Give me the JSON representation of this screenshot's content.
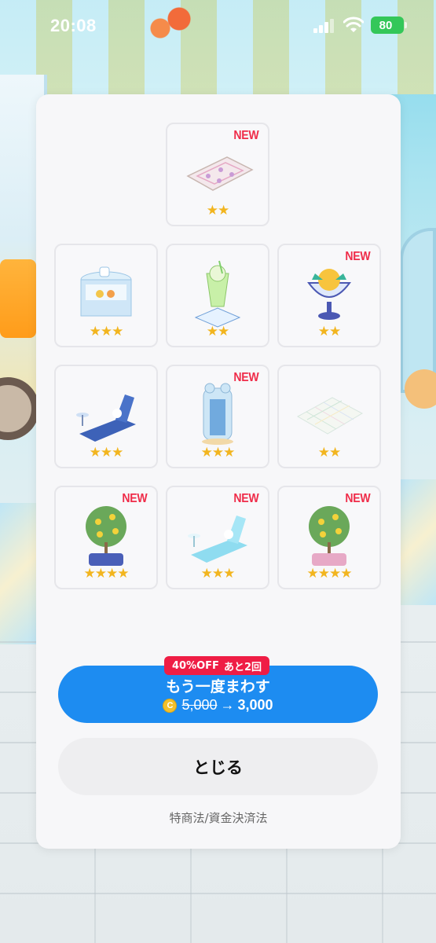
{
  "status_bar": {
    "time": "20:08",
    "battery": "80"
  },
  "items": [
    {
      "name": "tile-rug",
      "is_new": true,
      "stars": "★★"
    },
    {
      "name": "shop-counter",
      "is_new": false,
      "stars": "★★★"
    },
    {
      "name": "melon-soda",
      "is_new": false,
      "stars": "★★"
    },
    {
      "name": "mango-parfait",
      "is_new": true,
      "stars": "★★"
    },
    {
      "name": "blue-lounge-chair",
      "is_new": false,
      "stars": "★★★"
    },
    {
      "name": "shower-booth",
      "is_new": true,
      "stars": "★★★"
    },
    {
      "name": "pastel-floor-tile",
      "is_new": false,
      "stars": "★★"
    },
    {
      "name": "lemon-tree-blue",
      "is_new": true,
      "stars": "★★★★"
    },
    {
      "name": "aqua-lounge-chair",
      "is_new": true,
      "stars": "★★★"
    },
    {
      "name": "lemon-tree-pink",
      "is_new": true,
      "stars": "★★★★"
    }
  ],
  "labels": {
    "new": "NEW"
  },
  "spin": {
    "discount_badge": "40%OFF",
    "remaining": "あと2回",
    "label": "もう一度まわす",
    "coin_symbol": "C",
    "old_price": "5,000",
    "arrow": "→",
    "new_price": "3,000"
  },
  "close_label": "とじる",
  "legal_link": "特商法/資金決済法",
  "colors": {
    "accent": "#1d8cf1",
    "new_badge": "#ef2c49",
    "discount": "#ef1d45",
    "star": "#f2b51f"
  }
}
